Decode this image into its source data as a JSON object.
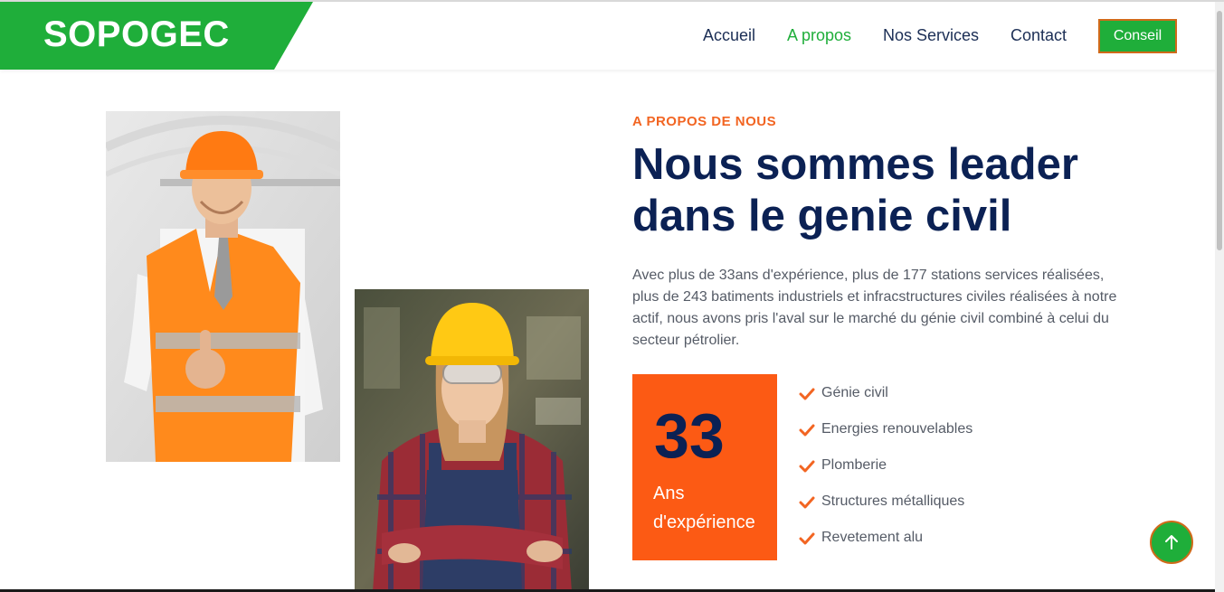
{
  "brand": {
    "name": "SOPOGEC",
    "color": "#1fae3a"
  },
  "nav": {
    "items": [
      {
        "label": "Accueil",
        "active": false
      },
      {
        "label": "A propos",
        "active": true
      },
      {
        "label": "Nos Services",
        "active": false
      },
      {
        "label": "Contact",
        "active": false
      }
    ],
    "cta_label": "Conseil"
  },
  "about": {
    "eyebrow": "A PROPOS DE NOUS",
    "heading_line1": "Nous sommes leader",
    "heading_line2": "dans le genie civil",
    "paragraph": "Avec plus de 33ans d'expérience, plus de 177 stations services réalisées, plus de 243 batiments industriels et infracstructures civiles réalisées à notre actif, nous avons pris l'aval sur le marché du génie civil combiné à celui du secteur pétrolier.",
    "experience": {
      "number": "33",
      "label_line1": "Ans",
      "label_line2": "d'expérience"
    },
    "features": [
      "Génie civil",
      "Energies renouvelables",
      "Plomberie",
      "Structures métalliques",
      "Revetement alu"
    ]
  },
  "colors": {
    "accent_green": "#1fae3a",
    "accent_orange": "#fc5a14",
    "navy": "#0b2154"
  },
  "icons": {
    "feature_icon": "check-icon",
    "back_to_top": "arrow-up-icon"
  }
}
